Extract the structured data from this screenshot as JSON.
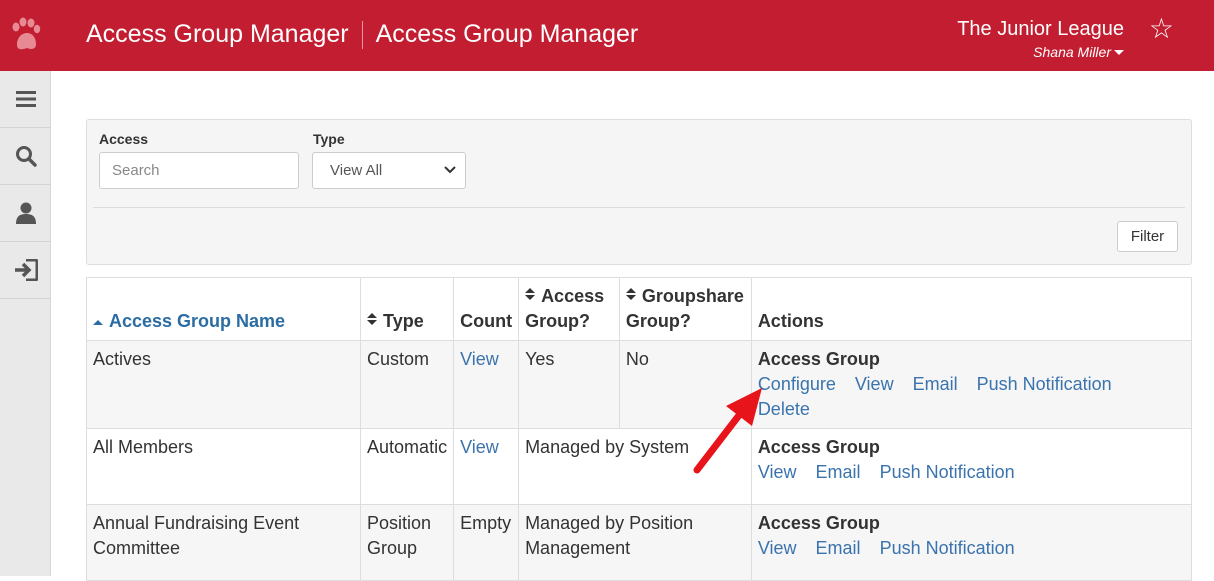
{
  "header": {
    "title_left": "Access Group Manager",
    "title_right": "Access Group Manager",
    "organization": "The Junior League",
    "user_name": "Shana Miller",
    "brand_color": "#c21d30"
  },
  "sidebar": {
    "items": [
      {
        "icon": "menu-icon"
      },
      {
        "icon": "search-icon"
      },
      {
        "icon": "user-icon"
      },
      {
        "icon": "logout-icon"
      }
    ]
  },
  "filter": {
    "access_label": "Access",
    "access_placeholder": "Search",
    "type_label": "Type",
    "type_value": "View All",
    "filter_button": "Filter"
  },
  "table": {
    "headers": {
      "name": "Access Group Name",
      "type": "Type",
      "count": "Count",
      "access_group_1": "Access",
      "access_group_2": "Group?",
      "groupshare_1": "Groupshare",
      "groupshare_2": "Group?",
      "actions": "Actions"
    },
    "rows": [
      {
        "name": "Actives",
        "type": "Custom",
        "count": "View",
        "access_group": "Yes",
        "groupshare": "No",
        "action_title": "Access Group",
        "actions": [
          "Configure",
          "View",
          "Email",
          "Push Notification",
          "Delete"
        ]
      },
      {
        "name": "All Members",
        "type": "Automatic",
        "count": "View",
        "managed": "Managed by System",
        "action_title": "Access Group",
        "actions": [
          "View",
          "Email",
          "Push Notification"
        ]
      },
      {
        "name_line1": "Annual Fundraising Event",
        "name_line2": "Committee",
        "type_line1": "Position",
        "type_line2": "Group",
        "count": "Empty",
        "managed_line1": "Managed by Position",
        "managed_line2": "Management",
        "action_title": "Access Group",
        "actions": [
          "View",
          "Email",
          "Push Notification"
        ]
      }
    ]
  }
}
